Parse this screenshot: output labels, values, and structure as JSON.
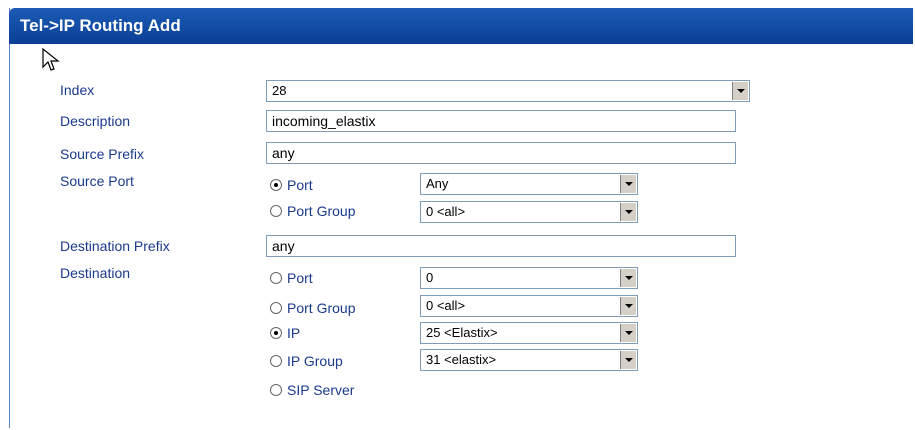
{
  "title": "Tel->IP Routing Add",
  "fields": {
    "index_label": "Index",
    "index_value": "28",
    "description_label": "Description",
    "description_value": "incoming_elastix",
    "source_prefix_label": "Source Prefix",
    "source_prefix_value": "any",
    "source_port_label": "Source Port",
    "destination_prefix_label": "Destination Prefix",
    "destination_prefix_value": "any",
    "destination_label": "Destination"
  },
  "source_port": {
    "port_label": "Port",
    "port_value": "Any",
    "port_group_label": "Port Group",
    "port_group_value": "0 <all>",
    "selected": "Port"
  },
  "destination": {
    "port_label": "Port",
    "port_value": "0",
    "port_group_label": "Port Group",
    "port_group_value": "0 <all>",
    "ip_label": "IP",
    "ip_value": "25 <Elastix>",
    "ip_group_label": "IP Group",
    "ip_group_value": "31 <elastix>",
    "sip_server_label": "SIP Server",
    "selected": "IP"
  },
  "icons": {
    "cursor": "mouse-pointer-icon",
    "dropdown": "dropdown-arrow-icon",
    "radio": "radio-button-icon"
  }
}
